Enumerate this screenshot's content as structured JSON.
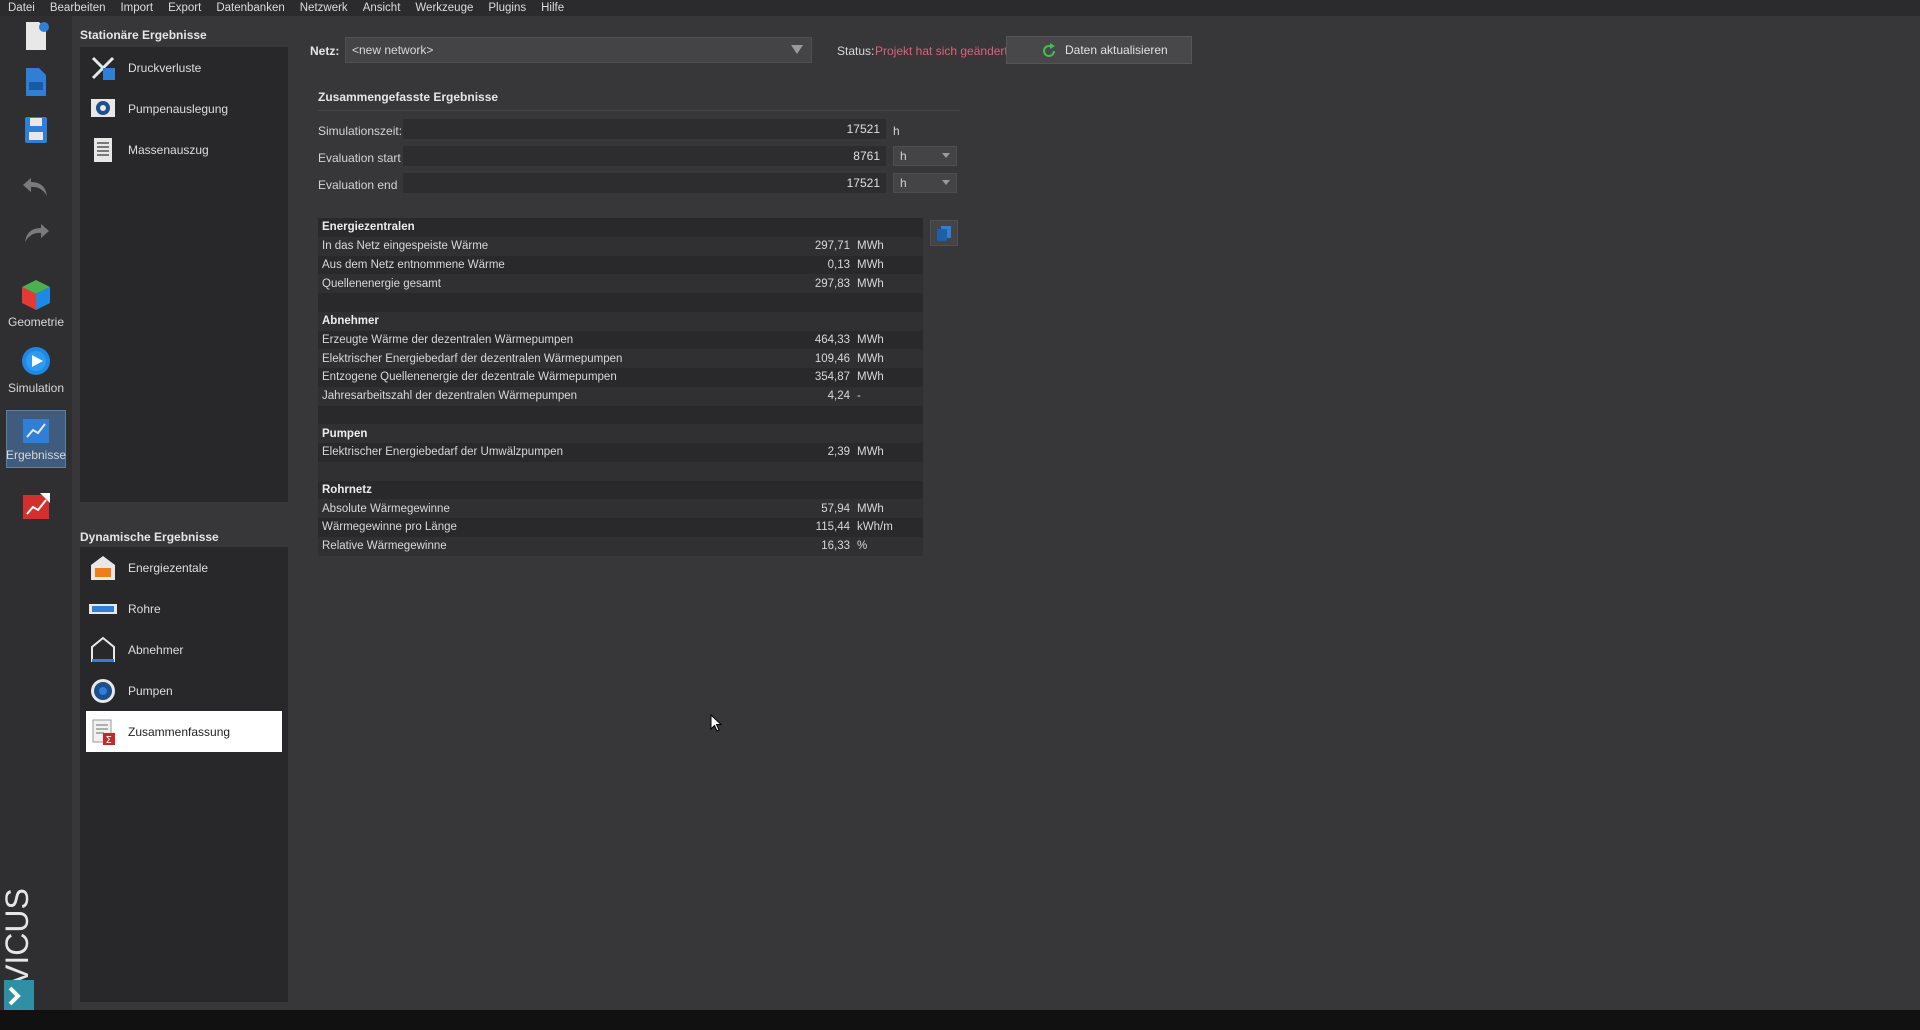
{
  "menu": [
    "Datei",
    "Bearbeiten",
    "Import",
    "Export",
    "Datenbanken",
    "Netzwerk",
    "Ansicht",
    "Werkzeuge",
    "Plugins",
    "Hilfe"
  ],
  "toolbar": {
    "geometry_label": "Geometrie",
    "simulation_label": "Simulation",
    "results_label": "Ergebnisse",
    "brand": "VICUS"
  },
  "stationary": {
    "title": "Stationäre Ergebnisse",
    "items": [
      "Druckverluste",
      "Pumpenauslegung",
      "Massenauszug"
    ]
  },
  "dynamic": {
    "title": "Dynamische Ergebnisse",
    "items": [
      "Energiezentale",
      "Rohre",
      "Abnehmer",
      "Pumpen",
      "Zusammenfassung"
    ]
  },
  "network": {
    "label": "Netz:",
    "value": "<new network>"
  },
  "status": {
    "label": "Status:",
    "value": "Projekt hat sich geändert",
    "color": "#e0607a"
  },
  "update_button": "Daten aktualisieren",
  "summary": {
    "title": "Zusammengefasste Ergebnisse",
    "sim_time_label": "Simulationszeit:",
    "sim_time_value": "17521",
    "sim_time_unit": "h",
    "eval_start_label": "Evaluation start",
    "eval_start_value": "8761",
    "eval_start_unit": "h",
    "eval_end_label": "Evaluation end",
    "eval_end_value": "17521",
    "eval_end_unit": "h"
  },
  "results_rows": [
    {
      "name": "Energiezentralen",
      "value": "",
      "unit": "",
      "head": true
    },
    {
      "name": "In das Netz eingespeiste Wärme",
      "value": "297,71",
      "unit": "MWh"
    },
    {
      "name": "Aus dem Netz entnommene Wärme",
      "value": "0,13",
      "unit": "MWh"
    },
    {
      "name": "Quellenenergie gesamt",
      "value": "297,83",
      "unit": "MWh"
    },
    {
      "name": "",
      "value": "",
      "unit": ""
    },
    {
      "name": "Abnehmer",
      "value": "",
      "unit": "",
      "head": true
    },
    {
      "name": "Erzeugte Wärme der dezentralen Wärmepumpen",
      "value": "464,33",
      "unit": "MWh"
    },
    {
      "name": "Elektrischer Energiebedarf der dezentralen Wärmepumpen",
      "value": "109,46",
      "unit": "MWh"
    },
    {
      "name": "Entzogene Quellenenergie der dezentrale Wärmepumpen",
      "value": "354,87",
      "unit": "MWh"
    },
    {
      "name": "Jahresarbeitszahl der dezentralen Wärmepumpen",
      "value": "4,24",
      "unit": "-"
    },
    {
      "name": "",
      "value": "",
      "unit": ""
    },
    {
      "name": "Pumpen",
      "value": "",
      "unit": "",
      "head": true
    },
    {
      "name": "Elektrischer Energiebedarf der Umwälzpumpen",
      "value": "2,39",
      "unit": "MWh"
    },
    {
      "name": "",
      "value": "",
      "unit": ""
    },
    {
      "name": "Rohrnetz",
      "value": "",
      "unit": "",
      "head": true
    },
    {
      "name": "Absolute Wärmegewinne",
      "value": "57,94",
      "unit": "MWh"
    },
    {
      "name": "Wärmegewinne pro Länge",
      "value": "115,44",
      "unit": "kWh/m"
    },
    {
      "name": "Relative Wärmegewinne",
      "value": "16,33",
      "unit": "%"
    }
  ]
}
